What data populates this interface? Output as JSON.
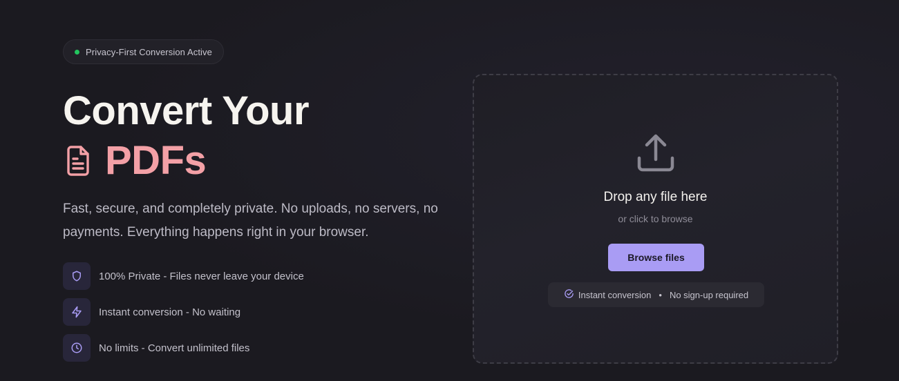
{
  "status": {
    "label": "Privacy-First Conversion Active",
    "dot_color": "#22c55e"
  },
  "hero": {
    "title_line1": "Convert Your",
    "title_accent": "PDFs",
    "accent_color": "#f3a0a6",
    "accent_icon": "document-icon",
    "description": "Fast, secure, and completely private. No uploads, no servers, no payments. Everything happens right in your browser."
  },
  "features": [
    {
      "icon": "shield-icon",
      "text": "100% Private - Files never leave your device"
    },
    {
      "icon": "lightning-icon",
      "text": "Instant conversion - No waiting"
    },
    {
      "icon": "clock-icon",
      "text": "No limits - Convert unlimited files"
    }
  ],
  "dropzone": {
    "icon": "upload-icon",
    "title": "Drop any file here",
    "subtitle": "or click to browse",
    "button_label": "Browse files",
    "button_color": "#a99cf4",
    "info_icon": "check-circle-icon",
    "info_left": "Instant conversion",
    "info_separator": "•",
    "info_right": "No sign-up required"
  }
}
